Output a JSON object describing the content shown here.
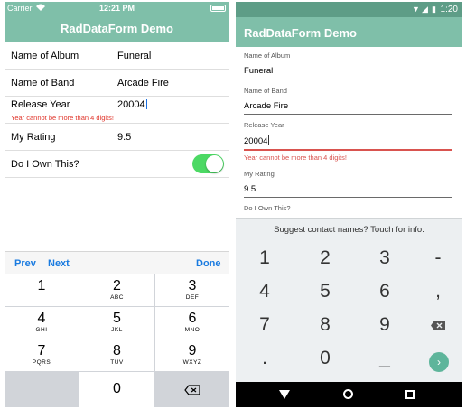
{
  "ios": {
    "status": {
      "carrier": "Carrier",
      "time": "12:21 PM"
    },
    "title": "RadDataForm Demo",
    "fields": [
      {
        "label": "Name of Album",
        "value": "Funeral"
      },
      {
        "label": "Name of Band",
        "value": "Arcade Fire"
      },
      {
        "label": "Release Year",
        "value": "20004",
        "error": "Year cannot be more than 4 digits!"
      },
      {
        "label": "My Rating",
        "value": "9.5"
      },
      {
        "label": "Do I Own This?",
        "toggle": true
      }
    ],
    "toolbar": {
      "prev": "Prev",
      "next": "Next",
      "done": "Done"
    },
    "keys": [
      {
        "num": "1",
        "letters": ""
      },
      {
        "num": "2",
        "letters": "ABC"
      },
      {
        "num": "3",
        "letters": "DEF"
      },
      {
        "num": "4",
        "letters": "GHI"
      },
      {
        "num": "5",
        "letters": "JKL"
      },
      {
        "num": "6",
        "letters": "MNO"
      },
      {
        "num": "7",
        "letters": "PQRS"
      },
      {
        "num": "8",
        "letters": "TUV"
      },
      {
        "num": "9",
        "letters": "WXYZ"
      },
      {
        "num": "0",
        "letters": ""
      }
    ],
    "delete_icon": "backspace-icon"
  },
  "android": {
    "status": {
      "time": "1:20"
    },
    "title": "RadDataForm Demo",
    "fields": [
      {
        "label": "Name of Album",
        "value": "Funeral"
      },
      {
        "label": "Name of Band",
        "value": "Arcade Fire"
      },
      {
        "label": "Release Year",
        "value": "20004",
        "error": "Year cannot be more than 4 digits!"
      },
      {
        "label": "My Rating",
        "value": "9.5"
      },
      {
        "label": "Do I Own This?"
      }
    ],
    "suggestion": "Suggest contact names? Touch for info.",
    "keys": [
      "1",
      "2",
      "3",
      "-",
      "4",
      "5",
      "6",
      ",",
      "7",
      "8",
      "9",
      ".",
      "0",
      "_"
    ],
    "next_icon": "arrow-right-icon",
    "colors": {
      "accent": "#7fbfa9",
      "error": "#d9534f",
      "toggle": "#4cd964"
    }
  }
}
